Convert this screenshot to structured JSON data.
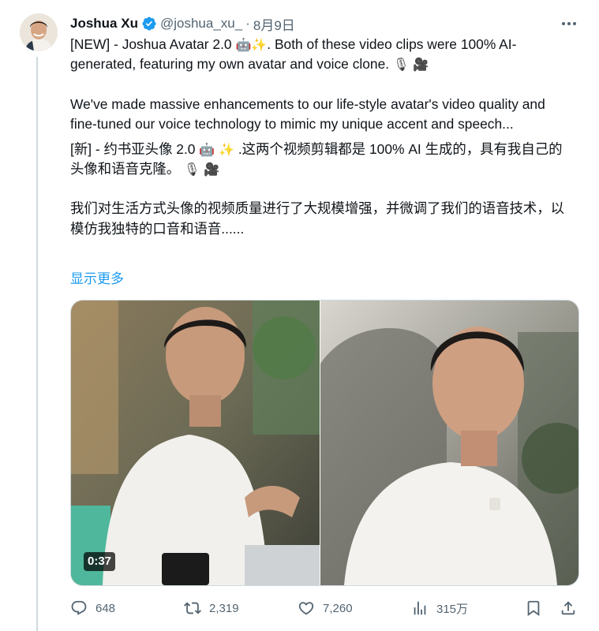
{
  "tweet": {
    "author": {
      "display_name": "Joshua Xu",
      "handle": "@joshua_xu_",
      "verified_icon": "verified-badge-icon"
    },
    "separator": "·",
    "date": "8月9日",
    "text_en_1a": "[NEW] - Joshua Avatar 2.0 ",
    "text_en_1b": ". Both of these video clips were 100% AI-generated, featuring my own avatar and voice clone. ",
    "text_en_2": "We've made massive enhancements to our life-style avatar's video quality and fine-tuned our voice technology to mimic my unique accent and speech...",
    "text_zh_1a": "[新] - 约书亚头像 2.0 ",
    "text_zh_1b": " .这两个视频剪辑都是 100% AI 生成的，具有我自己的头像和语音克隆。 ",
    "text_zh_2": "我们对生活方式头像的视频质量进行了大规模增强，并微调了我们的语音技术，以模仿我独特的口音和语音......",
    "emoji": {
      "robot": "🤖",
      "sparkles": "✨",
      "mic": "🎙",
      "camera": "🎥"
    },
    "show_more": "显示更多",
    "media": {
      "duration": "0:37"
    },
    "stats": {
      "replies": "648",
      "retweets": "2,319",
      "likes": "7,260",
      "views": "315万"
    },
    "icons": {
      "reply": "reply-icon",
      "retweet": "retweet-icon",
      "like": "heart-icon",
      "views": "views-icon",
      "bookmark": "bookmark-icon",
      "share": "share-icon",
      "more": "more-icon"
    }
  }
}
